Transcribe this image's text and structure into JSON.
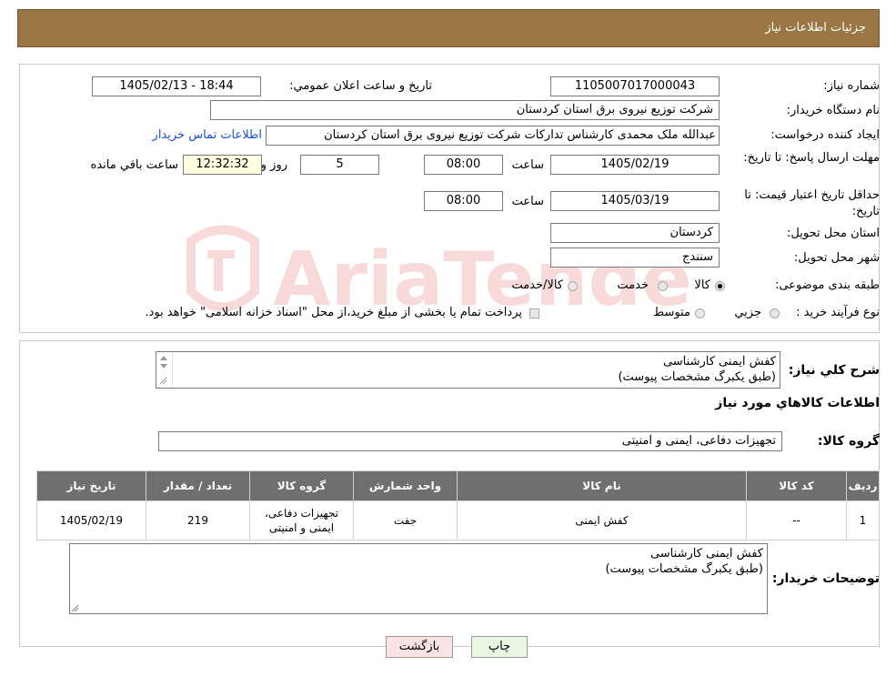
{
  "header": {
    "title": "جزئیات اطلاعات نیاز"
  },
  "details": {
    "need_number_label": "شماره نیاز:",
    "need_number": "1105007017000043",
    "announce_label": "تاریخ و ساعت اعلان عمومي:",
    "announce_value": "1405/02/13 - 18:44",
    "buyer_org_label": "نام دستگاه خریدار:",
    "buyer_org": "شرکت توزیع نیروی برق استان کردستان",
    "requester_label": "ایجاد کننده درخواست:",
    "requester": "عبدالله ملک محمدی کارشناس تدارکات شرکت توزیع نیروی برق استان کردستان",
    "contact_link": "اطلاعات تماس خریدار",
    "deadline_label": "مهلت ارسال پاسخ: تا تاریخ:",
    "deadline_date": "1405/02/19",
    "time_label": "ساعت",
    "deadline_time": "08:00",
    "days_value": "5",
    "days_label": "روز و",
    "remaining_value": "12:32:32",
    "remaining_label": "ساعت باقي مانده",
    "validity_label": "حداقل تاریخ اعتبار قیمت: تا تاریخ:",
    "validity_date": "1405/03/19",
    "validity_time": "08:00",
    "province_label": "استان محل تحویل:",
    "province": "کردستان",
    "city_label": "شهر محل تحویل:",
    "city": "سنندج",
    "category_label": "طبقه بندی موضوعی:",
    "category_options": [
      "کالا",
      "خدمت",
      "کالا/خدمت"
    ],
    "purchase_type_label": "نوع فرآیند خرید :",
    "purchase_options": [
      "جزیي",
      "متوسط"
    ],
    "purchase_note": "پرداخت تمام یا بخشی از مبلغ خرید،از محل \"اسناد خزانه اسلامی\" خواهد بود."
  },
  "summary": {
    "general_desc_label": "شرح کلي نیاز:",
    "general_desc": "کفش ایمنی کارشناسی\n(طبق یکبرگ مشخصات پیوست)",
    "items_info_title": "اطلاعات کالاهاي مورد نیاز",
    "goods_group_label": "گروه کالا:",
    "goods_group": "تجهیزات دفاعی، ایمنی و امنیتی"
  },
  "table": {
    "headers": [
      "ردیف",
      "کد کالا",
      "نام کالا",
      "واحد شمارش",
      "گروه کالا",
      "تعداد / مقدار",
      "تاریخ نیاز"
    ],
    "rows": [
      [
        "1",
        "--",
        "کفش ایمنی",
        "جفت",
        "تجهیزات دفاعی، ایمنی و امنیتی",
        "219",
        "1405/02/19"
      ]
    ]
  },
  "buyer_notes": {
    "label": "توضیحات خریدار:",
    "text": "کفش ایمنی کارشناسی\n(طبق یکبرگ مشخصات پیوست)"
  },
  "buttons": {
    "print": "چاپ",
    "back": "بازگشت"
  },
  "watermark": {
    "text": "AriaTender.neT"
  },
  "colors": {
    "header_bg": "#9a7644",
    "table_header_bg": "#6f6f6f",
    "link": "#1a4fd8"
  }
}
